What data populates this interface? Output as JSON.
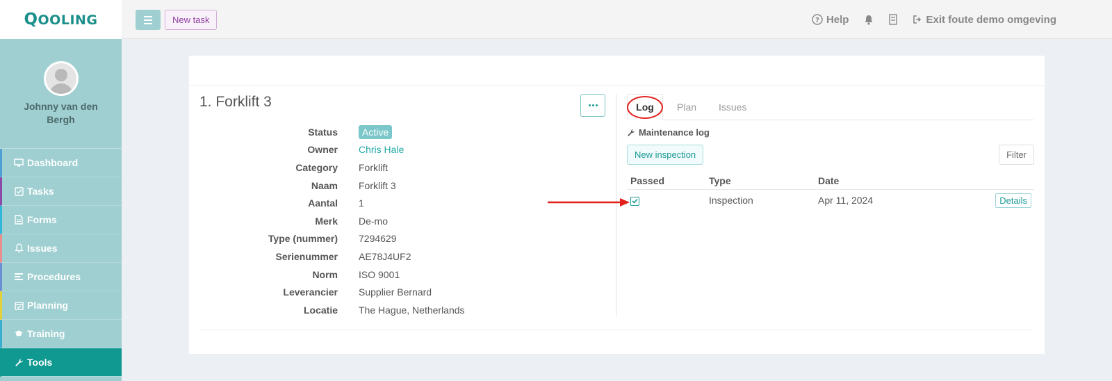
{
  "brand": {
    "logo_big": "Q",
    "logo_rest": "OOLING"
  },
  "colors": {
    "accent": "#1a9a95",
    "sidebar": "#9fcfd1",
    "active_nav": "#0f9990",
    "annotation": "#e3201b"
  },
  "user": {
    "name": "Johnny van den Bergh"
  },
  "nav": [
    {
      "label": "Dashboard",
      "icon": "monitor-icon",
      "color": "#4d9fd6"
    },
    {
      "label": "Tasks",
      "icon": "checkbox-icon",
      "color": "#8c4aa8"
    },
    {
      "label": "Forms",
      "icon": "document-icon",
      "color": "#2fb7d9"
    },
    {
      "label": "Issues",
      "icon": "bell-icon",
      "color": "#e98f8f"
    },
    {
      "label": "Procedures",
      "icon": "list-icon",
      "color": "#6b8fd1"
    },
    {
      "label": "Planning",
      "icon": "calendar-icon",
      "color": "#e3d13c"
    },
    {
      "label": "Training",
      "icon": "graduation-cap-icon",
      "color": "#3aaed1"
    },
    {
      "label": "Tools",
      "icon": "wrench-icon",
      "color": "#0f9990",
      "active": true
    }
  ],
  "topbar": {
    "new_task": "New task",
    "help": "Help",
    "exit": "Exit foute demo omgeving"
  },
  "tool": {
    "title": "1. Forklift 3",
    "properties": [
      {
        "label": "Status",
        "value": "Active",
        "type": "badge"
      },
      {
        "label": "Owner",
        "value": "Chris Hale",
        "type": "link"
      },
      {
        "label": "Category",
        "value": "Forklift"
      },
      {
        "label": "Naam",
        "value": "Forklift 3"
      },
      {
        "label": "Aantal",
        "value": "1"
      },
      {
        "label": "Merk",
        "value": "De-mo"
      },
      {
        "label": "Type (nummer)",
        "value": "7294629"
      },
      {
        "label": "Serienummer",
        "value": "AE78J4UF2"
      },
      {
        "label": "Norm",
        "value": "ISO 9001"
      },
      {
        "label": "Leverancier",
        "value": "Supplier Bernard"
      },
      {
        "label": "Locatie",
        "value": "The Hague, Netherlands"
      }
    ]
  },
  "tabs": {
    "log": "Log",
    "plan": "Plan",
    "issues": "Issues"
  },
  "log": {
    "section_label": "Maintenance log",
    "new_inspection": "New inspection",
    "filter": "Filter",
    "headers": {
      "passed": "Passed",
      "type": "Type",
      "date": "Date"
    },
    "rows": [
      {
        "passed": true,
        "type": "Inspection",
        "date": "Apr 11, 2024",
        "action": "Details"
      }
    ]
  }
}
